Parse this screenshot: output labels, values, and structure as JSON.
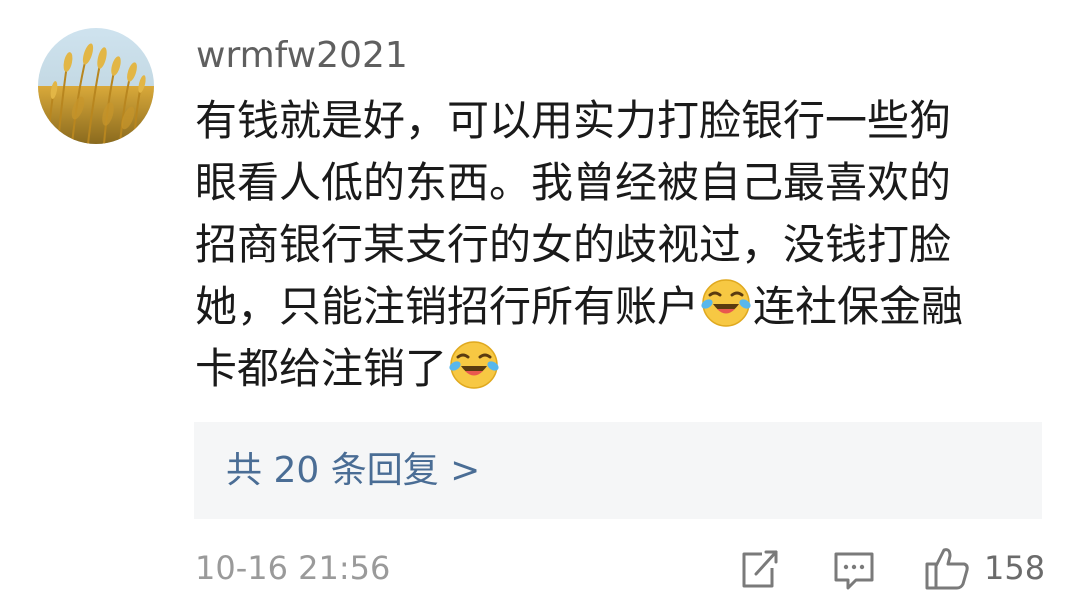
{
  "comment": {
    "username": "wrmfw2021",
    "text_lines": [
      "有钱就是好，可以用实力打脸银行一些狗",
      "眼看人低的东西。我曾经被自己最喜欢的",
      "招商银行某支行的女的歧视过，没钱打脸",
      "她，只能注销招行所有账户",
      "连社保金融",
      "卡都给注销了"
    ],
    "emoji_names": [
      "laughing-crying-emoji",
      "laughing-crying-emoji"
    ],
    "replies_label": "共 20 条回复 >",
    "timestamp": "10-16 21:56",
    "like_count": "158",
    "icons": [
      "share-icon",
      "reply-icon",
      "like-icon"
    ],
    "colors": {
      "link": "#4a6d95",
      "reply_box_bg": "#f5f6f7",
      "meta_text": "#9a9a9a"
    }
  }
}
